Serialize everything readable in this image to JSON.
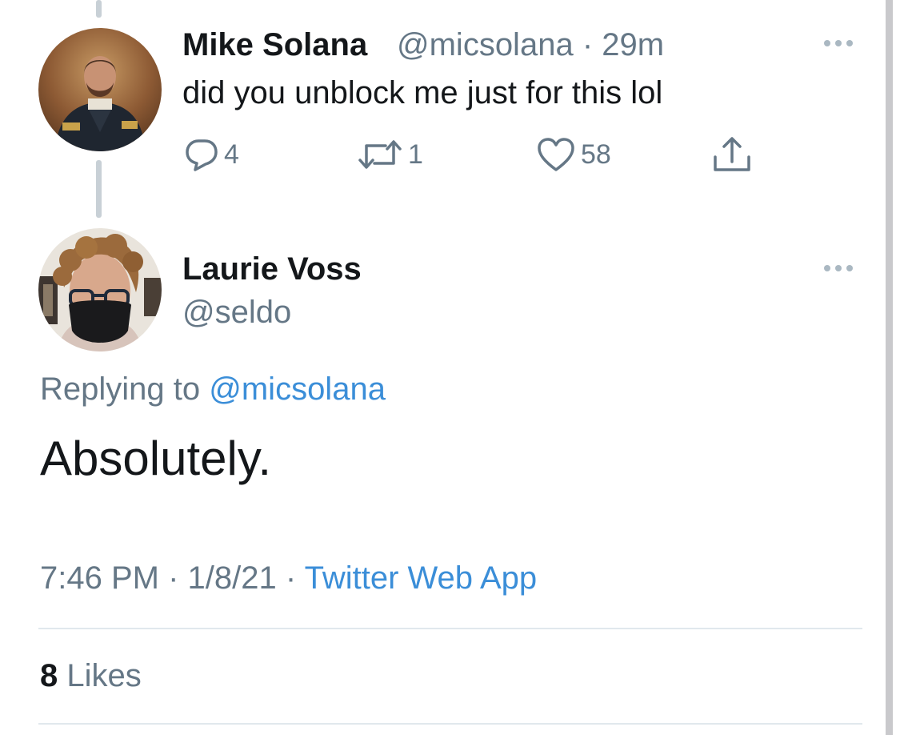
{
  "first_tweet": {
    "display_name": "Mike Solana",
    "handle": "@micsolana",
    "separator": "·",
    "time_ago": "29m",
    "text": "did you unblock me just for this lol",
    "avatar_icon": "painted-portrait-avatar",
    "actions": {
      "reply": {
        "icon": "reply-bubble-icon",
        "count": "4"
      },
      "retweet": {
        "icon": "retweet-icon",
        "count": "1"
      },
      "like": {
        "icon": "heart-icon",
        "count": "58"
      },
      "share": {
        "icon": "share-upload-icon"
      }
    }
  },
  "main_tweet": {
    "display_name": "Laurie Voss",
    "handle": "@seldo",
    "avatar_icon": "masked-person-avatar",
    "replying_to_label": "Replying to",
    "replying_to_handle": "@micsolana",
    "text": "Absolutely.",
    "time": "7:46 PM",
    "sep1": "·",
    "date": "1/8/21",
    "sep2": "·",
    "source": "Twitter Web App",
    "likes_count": "8",
    "likes_label": "Likes"
  },
  "colors": {
    "text": "#14171a",
    "secondary": "#657786",
    "link": "#3b8ed8",
    "divider": "#e1e8ed"
  }
}
